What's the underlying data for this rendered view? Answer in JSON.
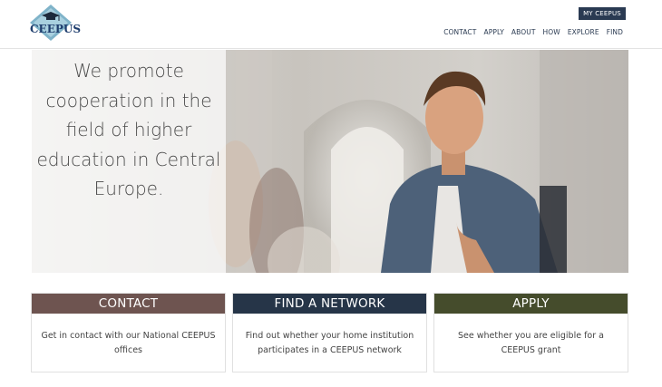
{
  "brand": {
    "logo_text": "CEEPUS"
  },
  "header": {
    "my_button": "MY CEEPUS",
    "nav": [
      "CONTACT",
      "APPLY",
      "ABOUT",
      "HOW",
      "EXPLORE",
      "FIND"
    ]
  },
  "hero": {
    "headline": "We promote cooperation in the field of higher education in Central Europe."
  },
  "cards": [
    {
      "title": "CONTACT",
      "text": "Get in contact with our National CEEPUS offices",
      "color": "#6e5450"
    },
    {
      "title": "FIND A NETWORK",
      "text": "Find out whether your home institution participates in a CEEPUS network",
      "color": "#263548"
    },
    {
      "title": "APPLY",
      "text": "See whether you are eligible for a CEEPUS grant",
      "color": "#454c2c"
    }
  ],
  "colors": {
    "nav_text": "#2b3b52",
    "button_bg": "#2a3a52",
    "logo_blue": "#1f3e6e"
  }
}
